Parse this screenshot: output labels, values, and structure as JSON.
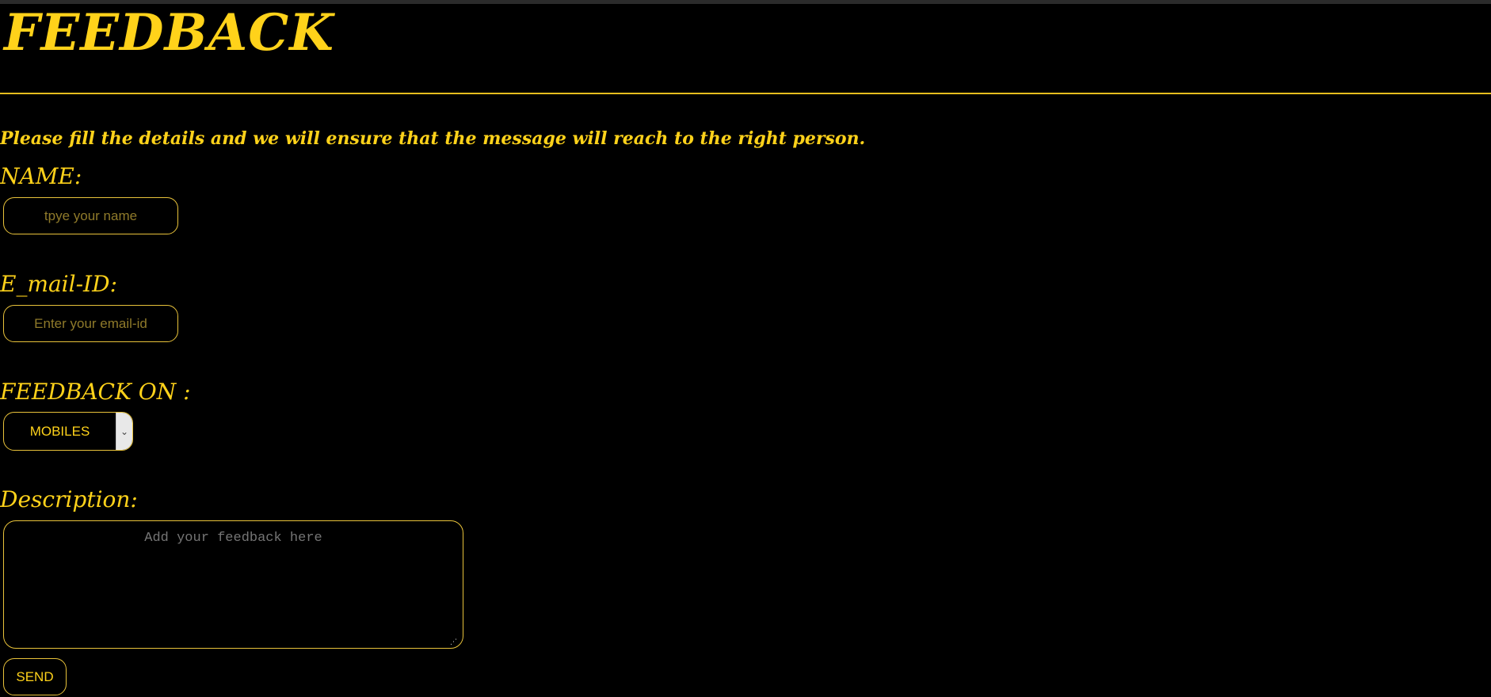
{
  "header": {
    "title": "FEEDBACK"
  },
  "intro_text": "Please fill the details and we will ensure that the message will reach to the right person.",
  "form": {
    "name": {
      "label": "NAME:",
      "placeholder": "tpye your name",
      "value": ""
    },
    "email": {
      "label": "E_mail-ID:",
      "placeholder": "Enter your email-id",
      "value": ""
    },
    "feedback_on": {
      "label": "FEEDBACK ON :",
      "selected": "MOBILES"
    },
    "description": {
      "label": "Description:",
      "placeholder": "Add your feedback here"
    },
    "send_label": "SEND"
  },
  "colors": {
    "background": "#000000",
    "accent": "#ffd21a",
    "border": "#e8c23a"
  },
  "icons": {
    "select_arrow": "chevron-down-icon",
    "resize": "resize-handle-icon"
  }
}
